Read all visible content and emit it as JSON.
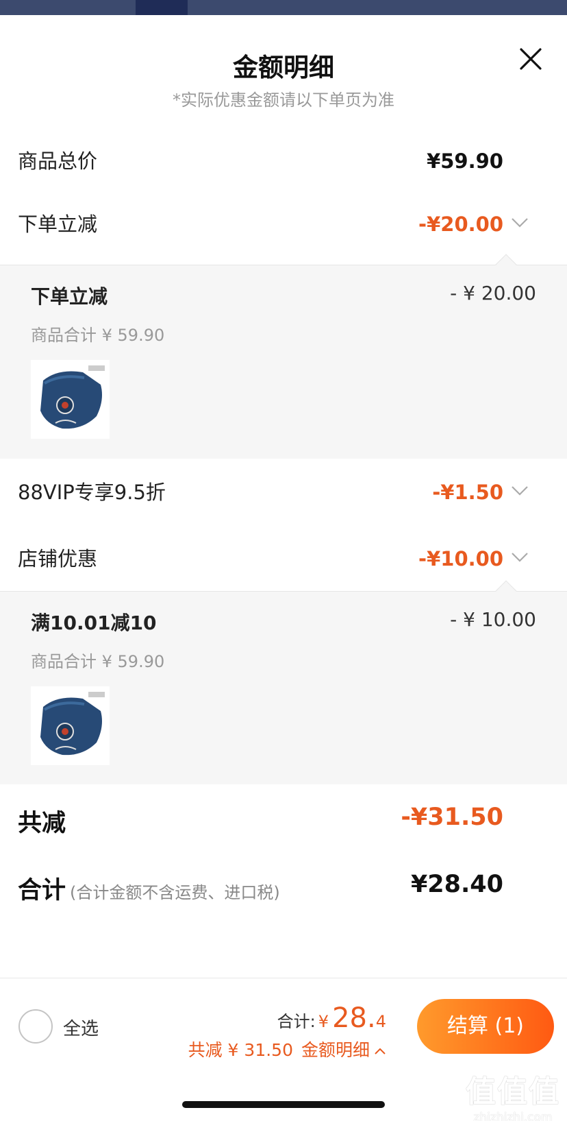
{
  "header": {
    "title": "金额明细",
    "subtitle": "*实际优惠金额请以下单页为准"
  },
  "rows": {
    "goods_total": {
      "label": "商品总价",
      "value": "¥59.90"
    },
    "instant_discount": {
      "label": "下单立减",
      "value": "-¥20.00"
    },
    "vip": {
      "label": "88VIP专享9.5折",
      "value": "-¥1.50"
    },
    "shop": {
      "label": "店铺优惠",
      "value": "-¥10.00"
    }
  },
  "instant_detail": {
    "name": "下单立减",
    "amount": "- ¥ 20.00",
    "subtotal": "商品合计 ¥ 59.90"
  },
  "shop_detail": {
    "name": "满10.01减10",
    "amount": "- ¥ 10.00",
    "subtotal": "商品合计 ¥ 59.90"
  },
  "summary": {
    "saved_label": "共减",
    "saved_value": "-¥31.50",
    "total_label": "合计",
    "total_note": "(合计金额不含运费、进口税)",
    "total_value": "¥28.40"
  },
  "bottom_bar": {
    "select_all": "全选",
    "total_label": "合计:",
    "currency": "¥",
    "total_main": "28.",
    "total_decimal": "4",
    "saving_text": "共减 ¥ 31.50",
    "detail_link": "金额明细",
    "checkout": "结算 (1)"
  },
  "watermark": {
    "glyphs": "值值值",
    "site": "zhizhizhi.com"
  },
  "colors": {
    "accent_orange": "#e85a1f",
    "checkout_gradient_start": "#ff9a2c",
    "checkout_gradient_end": "#ff5a12",
    "detail_bg": "#f6f6f6"
  },
  "icons": {
    "close": "close-icon",
    "expand": "chevron-down-icon",
    "collapse": "chevron-up-icon"
  }
}
